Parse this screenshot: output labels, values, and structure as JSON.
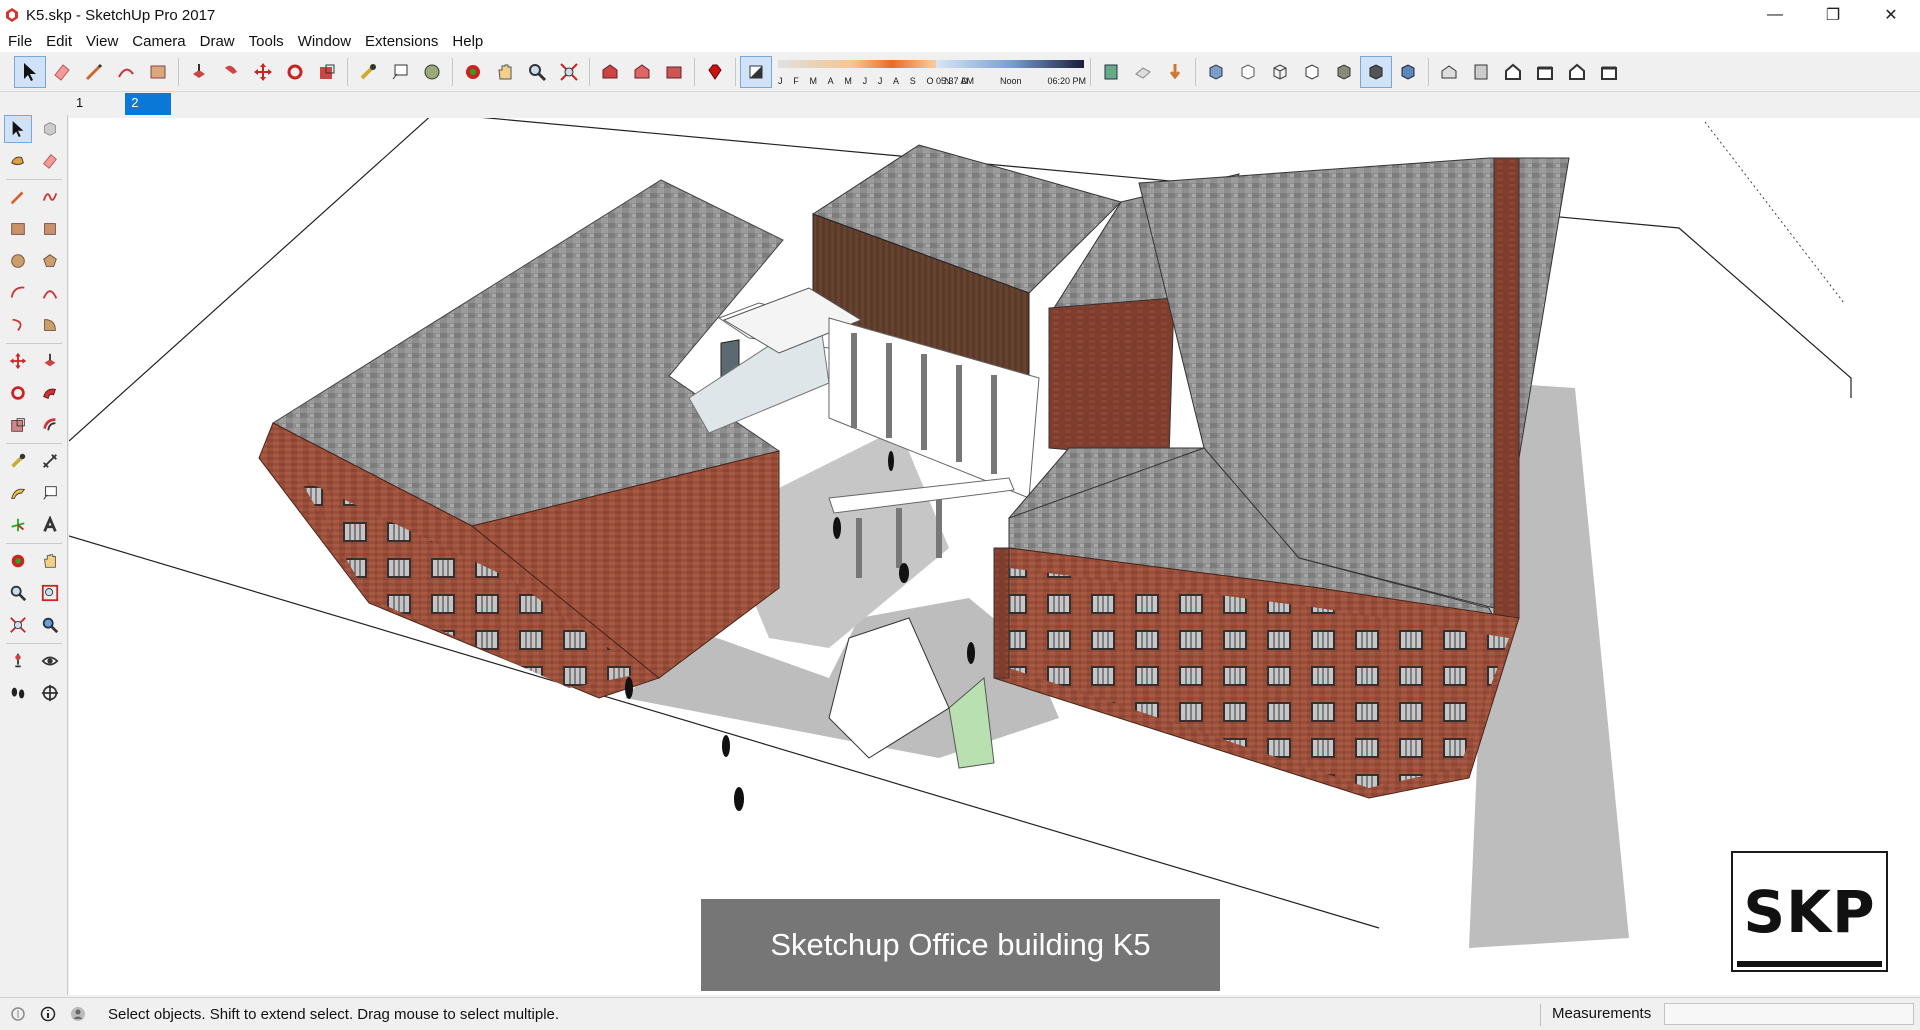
{
  "window": {
    "title": "K5.skp - SketchUp Pro 2017",
    "minimize": "—",
    "restore": "❐",
    "close": "✕"
  },
  "menu": [
    "File",
    "Edit",
    "View",
    "Camera",
    "Draw",
    "Tools",
    "Window",
    "Extensions",
    "Help"
  ],
  "toolbar": {
    "shadows": {
      "months": [
        "J",
        "F",
        "M",
        "A",
        "M",
        "J",
        "J",
        "A",
        "S",
        "O",
        "N",
        "D"
      ],
      "sunrise": "05:37 AM",
      "noon": "Noon",
      "sunset": "06:20 PM"
    }
  },
  "scenes": [
    "1",
    "2"
  ],
  "active_scene": "2",
  "viewport": {
    "caption": "Sketchup Office building K5",
    "logo": "SKP"
  },
  "status": {
    "hint": "Select objects. Shift to extend select. Drag mouse to select multiple.",
    "measurements_label": "Measurements",
    "measurements_value": ""
  },
  "colors": {
    "selection_accent": "#0a78d7",
    "brick": "#9b4f3b",
    "brick_dark": "#7a3a2a",
    "roof": "#8c8c8c",
    "shadow": "#bdbdbd"
  }
}
